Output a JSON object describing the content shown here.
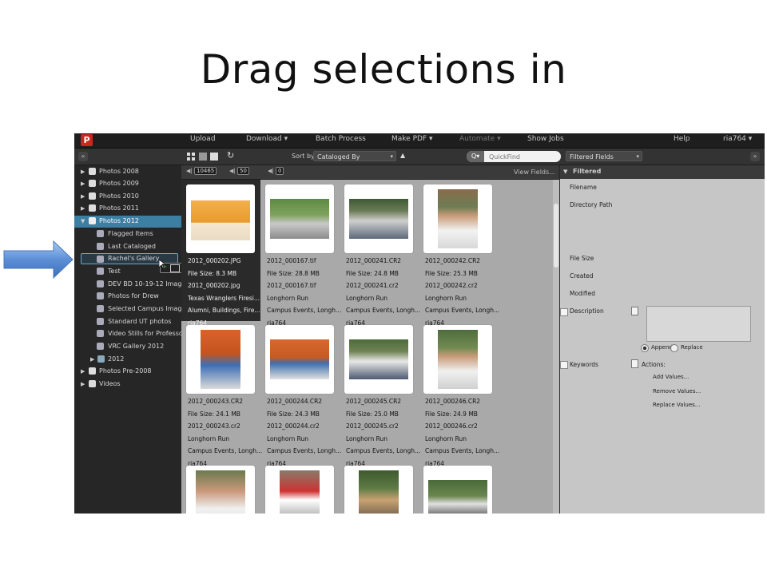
{
  "slide": {
    "title": "Drag selections in"
  },
  "app": {
    "logo": "P",
    "menu": [
      {
        "label": "Upload"
      },
      {
        "label": "Download ▾"
      },
      {
        "label": "Batch Process"
      },
      {
        "label": "Make PDF ▾"
      },
      {
        "label": "Automate ▾"
      },
      {
        "label": "Show Jobs"
      },
      {
        "label": "Help"
      },
      {
        "label": "ria764 ▾"
      }
    ],
    "toolbar": {
      "sort_label": "Sort by",
      "sort_value": "Cataloged By",
      "sort_direction": "▲",
      "search_placeholder": "QuickFind",
      "right_select": "Filtered Fields",
      "refresh_glyph": "↻"
    },
    "filterbar": {
      "count1": "10465",
      "count2": "50",
      "count3": "0",
      "view_fields": "View Fields..."
    },
    "sidebar": {
      "items": [
        {
          "label": "Photos 2008"
        },
        {
          "label": "Photos 2009"
        },
        {
          "label": "Photos 2010"
        },
        {
          "label": "Photos 2011"
        },
        {
          "label": "Photos 2012"
        },
        {
          "label": "Flagged Items"
        },
        {
          "label": "Last Cataloged"
        },
        {
          "label": "Rachel's Gallery"
        },
        {
          "label": "Test"
        },
        {
          "label": "DEV BD 10-19-12 Images"
        },
        {
          "label": "Photos for Drew"
        },
        {
          "label": "Selected Campus Images"
        },
        {
          "label": "Standard UT photos"
        },
        {
          "label": "Video Stills for Professor"
        },
        {
          "label": "VRC Gallery 2012"
        },
        {
          "label": "2012"
        },
        {
          "label": "Photos Pre-2008"
        },
        {
          "label": "Videos"
        }
      ],
      "drag_count": "1"
    },
    "assets": [
      {
        "name": "2012_000202.JPG",
        "size": "File Size: 8.3 MB",
        "file": "2012_000202.jpg",
        "title": "Texas Wranglers Firesi...",
        "keywords": "Alumni, Buildings, Fire...",
        "user": "ria764"
      },
      {
        "name": "2012_000167.tif",
        "size": "File Size: 28.8 MB",
        "file": "2012_000167.tif",
        "title": "Longhorn Run",
        "keywords": "Campus Events, Longh...",
        "user": "ria764"
      },
      {
        "name": "2012_000241.CR2",
        "size": "File Size: 24.8 MB",
        "file": "2012_000241.cr2",
        "title": "Longhorn Run",
        "keywords": "Campus Events, Longh...",
        "user": "ria764"
      },
      {
        "name": "2012_000242.CR2",
        "size": "File Size: 25.3 MB",
        "file": "2012_000242.cr2",
        "title": "Longhorn Run",
        "keywords": "Campus Events, Longh...",
        "user": "ria764"
      },
      {
        "name": "2012_000243.CR2",
        "size": "File Size: 24.1 MB",
        "file": "2012_000243.cr2",
        "title": "Longhorn Run",
        "keywords": "Campus Events, Longh...",
        "user": "ria764"
      },
      {
        "name": "2012_000244.CR2",
        "size": "File Size: 24.3 MB",
        "file": "2012_000244.cr2",
        "title": "Longhorn Run",
        "keywords": "Campus Events, Longh...",
        "user": "ria764"
      },
      {
        "name": "2012_000245.CR2",
        "size": "File Size: 25.0 MB",
        "file": "2012_000245.cr2",
        "title": "Longhorn Run",
        "keywords": "Campus Events, Longh...",
        "user": "ria764"
      },
      {
        "name": "2012_000246.CR2",
        "size": "File Size: 24.9 MB",
        "file": "2012_000246.cr2",
        "title": "Longhorn Run",
        "keywords": "Campus Events, Longh...",
        "user": "ria764"
      }
    ],
    "panel": {
      "header": "Filtered",
      "filename": "Filename",
      "directory": "Directory Path",
      "filesize": "File Size",
      "created": "Created",
      "modified": "Modified",
      "description": "Description",
      "append": "Append",
      "replace": "Replace",
      "keywords": "Keywords",
      "actions": "Actions:",
      "add_values": "Add Values...",
      "remove_values": "Remove Values...",
      "replace_values": "Replace Values..."
    }
  },
  "colors": {
    "accent_selected": "#3d7fa3",
    "arrow_fill": "#5b8fd6",
    "logo_red": "#c8281e"
  }
}
